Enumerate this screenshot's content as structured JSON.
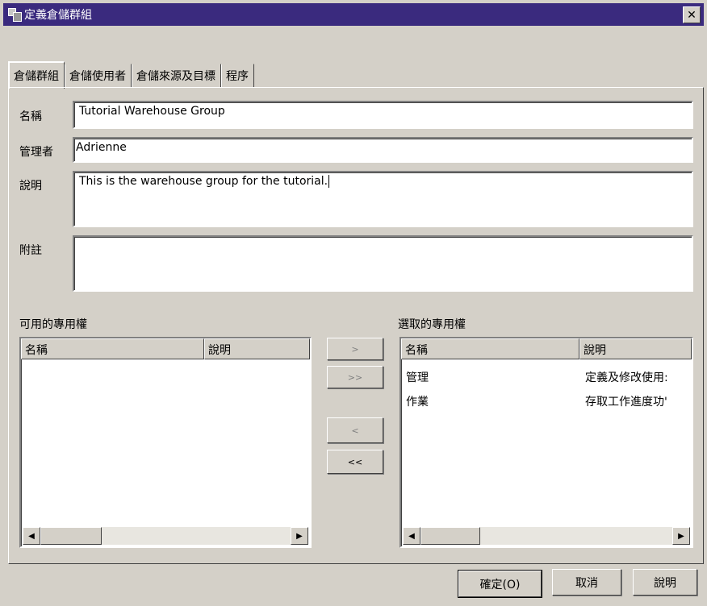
{
  "window": {
    "title": "定義倉儲群組",
    "close_glyph": "✕"
  },
  "tabs": [
    {
      "label": "倉儲群組"
    },
    {
      "label": "倉儲使用者"
    },
    {
      "label": "倉儲來源及目標"
    },
    {
      "label": "程序"
    }
  ],
  "form": {
    "name_label": "名稱",
    "name_value": "Tutorial Warehouse Group",
    "admin_label": "管理者",
    "admin_value": "Adrienne",
    "desc_label": "說明",
    "desc_value": "This is the warehouse group for the tutorial.",
    "notes_label": "附註",
    "notes_value": ""
  },
  "available": {
    "label": "可用的專用權",
    "columns": [
      "名稱",
      "說明"
    ],
    "rows": []
  },
  "selected": {
    "label": "選取的專用權",
    "columns": [
      "名稱",
      "說明"
    ],
    "rows": [
      {
        "name": "管理",
        "desc": "定義及修改使用:"
      },
      {
        "name": "作業",
        "desc": "存取工作進度功'"
      }
    ]
  },
  "move_buttons": {
    "add": ">",
    "add_all": ">>",
    "remove": "<",
    "remove_all": "<<"
  },
  "buttons": {
    "ok": "確定(O)",
    "cancel": "取消",
    "help": "說明"
  },
  "icons": {
    "window": "warehouse-group-icon",
    "scroll_left": "◀",
    "scroll_right": "▶"
  }
}
